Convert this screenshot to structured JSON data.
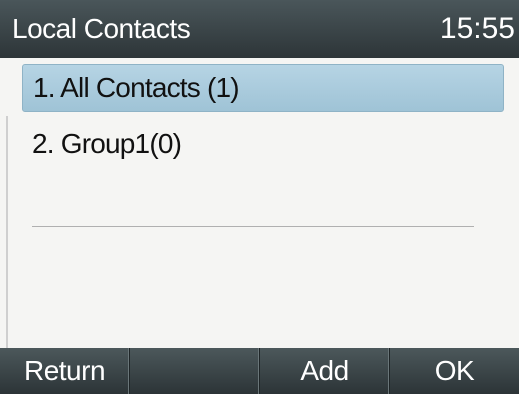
{
  "header": {
    "title": "Local Contacts",
    "time": "15:55"
  },
  "list": {
    "items": [
      {
        "label": "1. All Contacts (1)",
        "selected": true
      },
      {
        "label": "2. Group1(0)",
        "selected": false
      }
    ]
  },
  "softkeys": [
    {
      "label": "Return"
    },
    {
      "label": ""
    },
    {
      "label": "Add"
    },
    {
      "label": "OK"
    }
  ],
  "colors": {
    "header_bg": "#3a4548",
    "selection_bg": "#a9cadc",
    "list_bg": "#f5f5f3"
  }
}
